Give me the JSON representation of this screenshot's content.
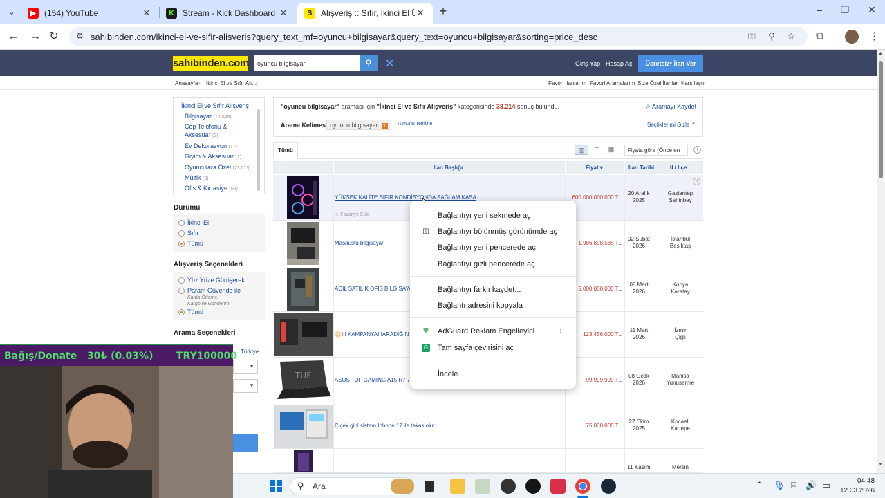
{
  "browser": {
    "tabs": [
      {
        "title": "(154) YouTube",
        "favicon_color": "#ff0000",
        "favicon_glyph": "▶"
      },
      {
        "title": "Stream - Kick Dashboard",
        "favicon_color": "#1a1a1a",
        "favicon_glyph": "K"
      },
      {
        "title": "Alışveriş :: Sıfır, İkinci El Ürünler",
        "favicon_color": "#ffe800",
        "favicon_glyph": "S",
        "active": true
      }
    ],
    "url": "sahibinden.com/ikinci-el-ve-sifir-alisveris?query_text_mf=oyuncu+bilgisayar&query_text=oyuncu+bilgisayar&sorting=price_desc"
  },
  "site": {
    "logo": "sahibinden.com",
    "search_value": "oyuncu bilgisayar",
    "login": "Giriş Yap",
    "register": "Hesap Aç",
    "post_ad": "Ücretsiz* İlan Ver",
    "breadcrumb": [
      "Anasayfa",
      "İkinci El ve Sıfır Alı..."
    ],
    "top_links": [
      "Favori İlanlarım",
      "Favori Aramalarım",
      "Size Özel İlanlar",
      "Karşılaştır"
    ]
  },
  "sidebar": {
    "root": "İkinci El ve Sıfır Alışveriş",
    "categories": [
      {
        "label": "Bilgisayar",
        "count": "(10.048)"
      },
      {
        "label": "Cep Telefonu &",
        "count": ""
      },
      {
        "label": "Aksesuar",
        "count": "(2)"
      },
      {
        "label": "Ev Dekorasyon",
        "count": "(77)"
      },
      {
        "label": "Giyim & Aksesuar",
        "count": "(1)"
      },
      {
        "label": "Oyunculara Özel",
        "count": "(23.015)"
      },
      {
        "label": "Müzik",
        "count": "(3)"
      },
      {
        "label": "Ofis & Kırtasiye",
        "count": "(68)"
      }
    ],
    "condition_title": "Durumu",
    "condition": [
      "İkinci El",
      "Sıfır",
      "Tümü"
    ],
    "shopping_title": "Alışveriş Seçenekleri",
    "shopping": [
      "Yüz Yüze Görüşerek",
      "Param Güvende ile",
      "Tümü"
    ],
    "shopping_sub": [
      "Kartla Ödeme,",
      "Kargo ile Gönderim"
    ],
    "search_options_title": "Arama Seçenekleri",
    "country": "Türkiye"
  },
  "results": {
    "query": "\"oyuncu bilgisayar\"",
    "mid1": " araması için ",
    "category": "\"İkinci El ve Sıfır Alışveriş\"",
    "mid2": " kategorisinde ",
    "count": "33.214",
    "tail": " sonuç bulundu.",
    "save_search": "Aramayı Kaydet",
    "keyword_label": "Arama Kelimesi",
    "keyword": "oyuncu bilgisayar",
    "clear_all": "Tümünü Temizle",
    "hide_selected": "Seçtiklerimi Gizle",
    "tab_all": "Tümü",
    "sort": "Fiyata göre (Önce en ...",
    "headers": {
      "title": "İlan Başlığı",
      "price": "Fiyat",
      "date": "İlan Tarihi",
      "location": "İl / İlçe"
    },
    "fav_add": "Favoriye Ekle",
    "rows": [
      {
        "title": "YÜKSEK KALİTE SIFIR KONDİSYONDA SAĞLAM KASA",
        "price": "600.000.000.000 TL",
        "date1": "20 Aralık",
        "date2": "2025",
        "loc1": "Gaziantep",
        "loc2": "Şahinbey"
      },
      {
        "title": "Masaüstü bilgisayar",
        "price": "1.986.898.585 TL",
        "date1": "02 Şubat",
        "date2": "2026",
        "loc1": "İstanbul",
        "loc2": "Beşiktaş"
      },
      {
        "title": "ACİL SATILIK OFİS BİLGİSAYA",
        "price": "5.000.000.000 TL",
        "date1": "08 Mart",
        "date2": "2026",
        "loc1": "Konya",
        "loc2": "Karatay"
      },
      {
        "title": "🔆!!! KAMPANYA!!!ARADIĞIN",
        "price": "123.456.000 TL",
        "date1": "11 Mart",
        "date2": "2026",
        "loc1": "İzmir",
        "loc2": "Çiğli"
      },
      {
        "title": "ASUS TUF GAMING A15 R7 7",
        "price": "99.999.999 TL",
        "date1": "08 Ocak",
        "date2": "2026",
        "loc1": "Manisa",
        "loc2": "Yunusemre"
      },
      {
        "title": "Çiçek gibi sistem Iphone 17 ile takas olur",
        "price": "75.000.000 TL",
        "date1": "27 Ekim",
        "date2": "2025",
        "loc1": "Kocaeli",
        "loc2": "Kartepe"
      },
      {
        "title": "",
        "price": "",
        "date1": "11 Kasım",
        "date2": "",
        "loc1": "Mersin",
        "loc2": ""
      }
    ]
  },
  "context_menu": {
    "items": [
      "Bağlantıyı yeni sekmede aç",
      "Bağlantıyı bölünmüş görünümde aç",
      "Bağlantıyı yeni pencerede aç",
      "Bağlantıyı gizli pencerede aç",
      "Bağlantıyı farklı kaydet...",
      "Bağlantı adresini kopyala",
      "AdGuard Reklam Engelleyici",
      "Tam sayfa çevirisini aç",
      "İncele"
    ]
  },
  "overlay": {
    "donate_label": "Bağış/Donate",
    "donate_progress": "30₺ (0.03%)",
    "donate_goal": "TRY100000"
  },
  "taskbar": {
    "search_label": "Ara",
    "time": "04:48",
    "date": "12.03.2026"
  },
  "colors": {
    "header_bg": "#3c4563",
    "accent": "#4a90e2",
    "price": "#c0392b",
    "link": "#1a4a9c",
    "logo": "#ffe800"
  }
}
